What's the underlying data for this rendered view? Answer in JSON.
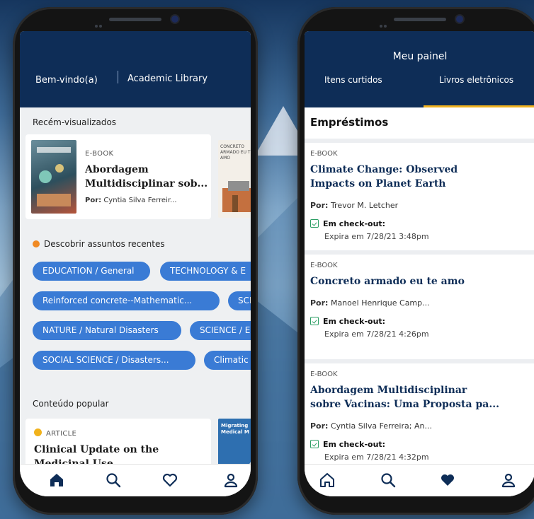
{
  "left_phone": {
    "header": {
      "welcome": "Bem-vindo(a)",
      "library": "Academic  Library"
    },
    "recent": {
      "title": "Recém-visualizados",
      "item": {
        "tag": "E-BOOK",
        "title_line1": "Abordagem",
        "title_line2": "Multidisciplinar sob...",
        "author_label": "Por:",
        "author": "Cyntia Silva Ferreir..."
      },
      "next_cover_text": "CONCRETO ARMADO EU TE AMO"
    },
    "subjects": {
      "title": "Descobrir assuntos recentes",
      "rows": [
        [
          "EDUCATION / General",
          "TECHNOLOGY & E"
        ],
        [
          "Reinforced concrete--Mathematic...",
          "SCIE"
        ],
        [
          "NATURE / Natural Disasters",
          "SCIENCE / Er"
        ],
        [
          "SOCIAL SCIENCE / Disasters...",
          "Climatic c"
        ]
      ]
    },
    "popular": {
      "title": "Conteúdo popular",
      "item": {
        "tag": "ARTICLE",
        "title_line1": "Clinical Update on the",
        "title_line2": "Medicinal Use"
      },
      "next_cover_text": "Migrating Medical M"
    }
  },
  "right_phone": {
    "header": {
      "title": "Meu painel",
      "tab_liked": "Itens curtidos",
      "tab_ebooks": "Livros eletrônicos"
    },
    "loans_title": "Empréstimos",
    "loans": [
      {
        "tag": "E-BOOK",
        "title_line1": "Climate Change: Observed",
        "title_line2": "Impacts on Planet Earth",
        "author_label": "Por:",
        "author": "Trevor M. Letcher",
        "status": "Em check-out:",
        "expiry": "Expira em 7/28/21 3:48pm"
      },
      {
        "tag": "E-BOOK",
        "title_line1": "Concreto armado eu te amo",
        "title_line2": "",
        "author_label": "Por:",
        "author": "Manoel Henrique Camp...",
        "status": "Em check-out:",
        "expiry": "Expira em 7/28/21 4:26pm"
      },
      {
        "tag": "E-BOOK",
        "title_line1": "Abordagem Multidisciplinar",
        "title_line2": "sobre Vacinas: Uma Proposta pa...",
        "author_label": "Por:",
        "author": "Cyntia Silva Ferreira; An...",
        "status": "Em check-out:",
        "expiry": "Expira em 7/28/21 4:32pm"
      }
    ]
  },
  "colors": {
    "header_navy": "#0e2d57",
    "pill_blue": "#3a7bd5",
    "accent_gold": "#f0b11e",
    "check_green": "#2c9e64"
  },
  "icons": [
    "home-icon",
    "search-icon",
    "heart-icon",
    "user-icon"
  ]
}
